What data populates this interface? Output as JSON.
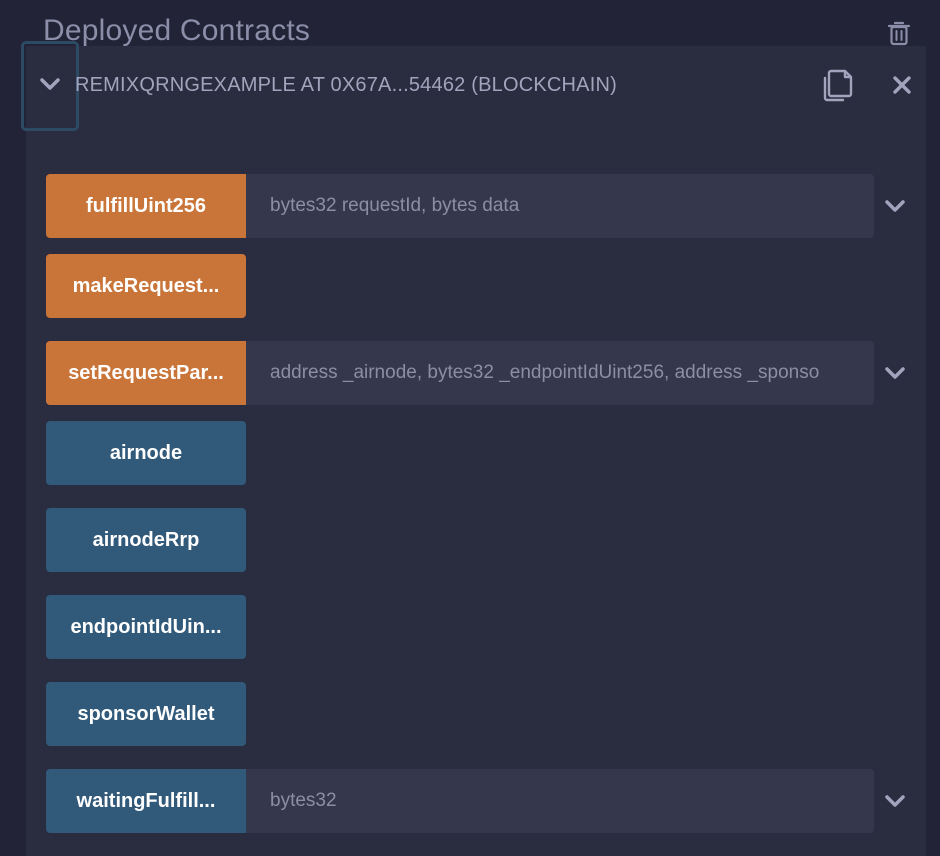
{
  "header": {
    "title": "Deployed Contracts"
  },
  "instance": {
    "title": "REMIXQRNGEXAMPLE AT 0X67A...54462 (BLOCKCHAIN)"
  },
  "functions": [
    {
      "label": "fulfillUint256",
      "placeholder": "bytes32 requestId, bytes data",
      "kind": "transact"
    },
    {
      "label": "makeRequest...",
      "kind": "transact"
    },
    {
      "label": "setRequestPar...",
      "placeholder": "address _airnode, bytes32 _endpointIdUint256, address _sponso",
      "kind": "transact"
    },
    {
      "label": "airnode",
      "kind": "call"
    },
    {
      "label": "airnodeRrp",
      "kind": "call"
    },
    {
      "label": "endpointIdUin...",
      "kind": "call"
    },
    {
      "label": "sponsorWallet",
      "kind": "call"
    },
    {
      "label": "waitingFulfill...",
      "placeholder": "bytes32",
      "kind": "call"
    }
  ],
  "icons": {
    "delete": "trash-icon",
    "toggle": "chevron-down-icon",
    "copy": "copy-icon",
    "close": "close-icon",
    "expand": "chevron-down-icon"
  },
  "colors": {
    "transact": "#c97539",
    "call": "#31597a",
    "background": "#222336",
    "panel": "#2a2c3f",
    "input": "#35374d"
  }
}
